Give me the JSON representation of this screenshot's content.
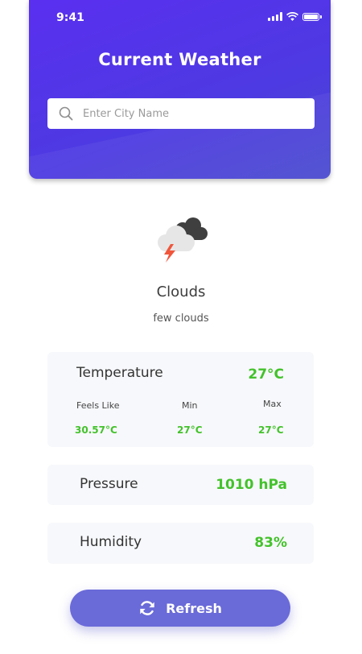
{
  "status_bar": {
    "time": "9:41"
  },
  "header": {
    "title": "Current Weather",
    "search": {
      "placeholder": "Enter City Name",
      "value": ""
    }
  },
  "weather": {
    "icon": "cloud-lightning-icon",
    "condition": "Clouds",
    "description": "few clouds"
  },
  "temperature_card": {
    "label": "Temperature",
    "value": "27°C",
    "feels_like": {
      "label": "Feels Like",
      "value": "30.57°C"
    },
    "min": {
      "label": "Min",
      "value": "27°C"
    },
    "max": {
      "label": "Max",
      "value": "27°C"
    }
  },
  "pressure_card": {
    "label": "Pressure",
    "value": "1010 hPa"
  },
  "humidity_card": {
    "label": "Humidity",
    "value": "83%"
  },
  "refresh_button": {
    "label": "Refresh",
    "icon": "refresh-icon"
  },
  "colors": {
    "accent": "#5a2ff0",
    "value_green": "#43c22b",
    "button": "#6a6ad9"
  }
}
